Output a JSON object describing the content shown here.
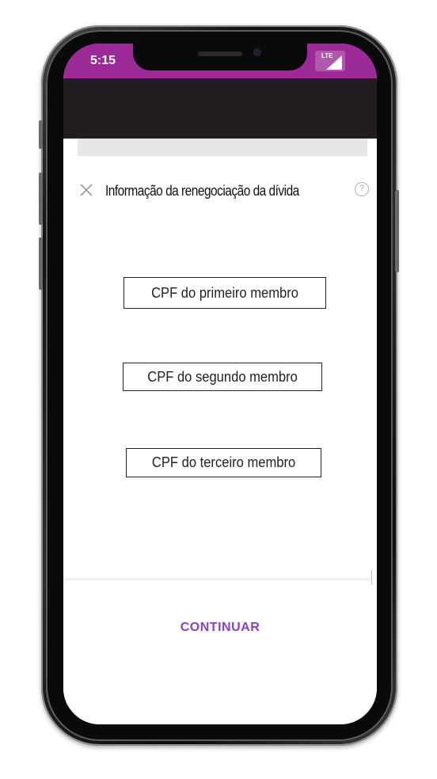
{
  "status_bar": {
    "time": "5:15",
    "network": "LTE",
    "color": "#9c2a96"
  },
  "sheet": {
    "title": "Informação da renegociação da dívida",
    "close_icon": "close-icon",
    "help_icon": "help-icon",
    "help_glyph": "?"
  },
  "fields": [
    {
      "placeholder": "CPF do primeiro membro"
    },
    {
      "placeholder": "CPF do segundo membro"
    },
    {
      "placeholder": "CPF do terceiro membro"
    }
  ],
  "footer": {
    "continue_label": "CONTINUAR",
    "accent": "#8a3fd1"
  }
}
